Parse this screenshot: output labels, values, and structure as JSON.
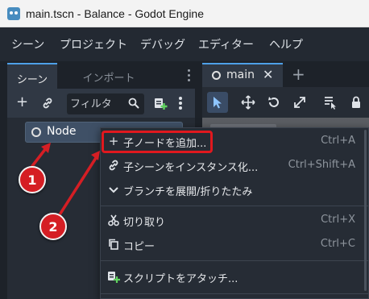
{
  "window": {
    "title": "main.tscn - Balance - Godot Engine"
  },
  "menubar": {
    "items": [
      "シーン",
      "プロジェクト",
      "デバッグ",
      "エディター",
      "ヘルプ"
    ]
  },
  "scene_dock": {
    "tabs": [
      {
        "label": "シーン",
        "active": true
      },
      {
        "label": "インポート",
        "active": false
      }
    ],
    "filter_placeholder": "フィルタ",
    "tree": [
      {
        "label": "Node",
        "selected": true
      }
    ]
  },
  "viewport": {
    "tab_label": "main"
  },
  "context_menu": {
    "items": [
      {
        "label": "子ノードを追加...",
        "shortcut": "Ctrl+A",
        "icon": "plus-icon",
        "highlighted": true
      },
      {
        "label": "子シーンをインスタンス化...",
        "shortcut": "Ctrl+Shift+A",
        "icon": "link-icon"
      },
      {
        "label": "ブランチを展開/折りたたみ",
        "shortcut": "",
        "icon": "chevron-down-icon"
      },
      {
        "label": "切り取り",
        "shortcut": "Ctrl+X",
        "icon": "scissors-icon"
      },
      {
        "label": "コピー",
        "shortcut": "Ctrl+C",
        "icon": "copy-icon"
      },
      {
        "label": "スクリプトをアタッチ...",
        "shortcut": "",
        "icon": "attach-script-icon"
      }
    ]
  },
  "callouts": [
    {
      "number": "1"
    },
    {
      "number": "2"
    }
  ],
  "colors": {
    "accent": "#4ea0e8",
    "callout": "#d51e24",
    "highlight_border": "#e0181e"
  }
}
